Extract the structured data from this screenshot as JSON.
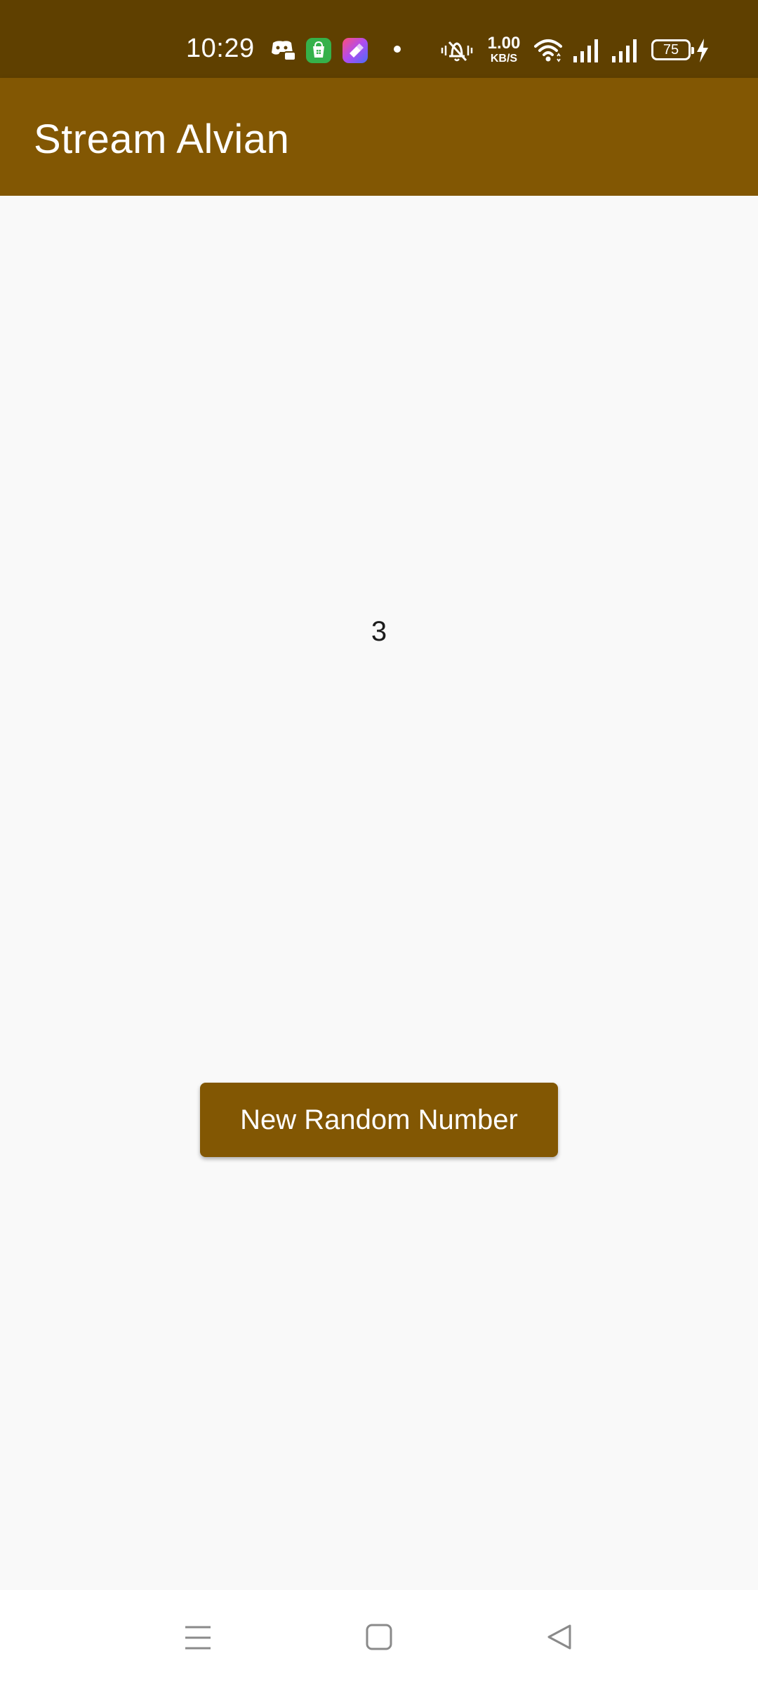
{
  "status_bar": {
    "time": "10:29",
    "net_speed_value": "1.00",
    "net_speed_unit": "KB/S",
    "battery_level": "75",
    "icons": [
      "discord-icon",
      "store-icon",
      "shortcut-icon",
      "dot-icon",
      "mute-icon",
      "wifi-icon",
      "signal-icon",
      "signal-icon",
      "battery-icon",
      "charging-icon"
    ]
  },
  "app_bar": {
    "title": "Stream Alvian"
  },
  "main": {
    "number": "3",
    "button_label": "New Random Number"
  },
  "nav_bar": {
    "icons": [
      "menu-icon",
      "home-icon",
      "back-icon"
    ]
  },
  "colors": {
    "status_bar_bg": "#5f4000",
    "app_bar_bg": "#825703",
    "button_bg": "#825703",
    "content_bg": "#f9f9f9",
    "nav_bar_bg": "#ffffff"
  }
}
